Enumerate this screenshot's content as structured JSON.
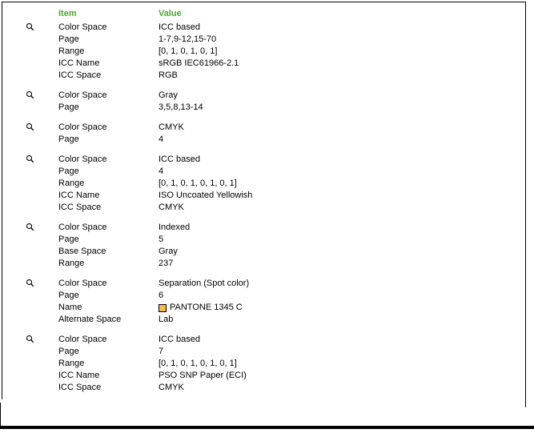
{
  "headers": {
    "item": "Item",
    "value": "Value"
  },
  "swatchColor": "#f5b94f",
  "sections": [
    {
      "rows": [
        {
          "label": "Color Space",
          "value": "ICC based"
        },
        {
          "label": "Page",
          "value": "1-7,9-12,15-70"
        },
        {
          "label": "Range",
          "value": "[0, 1, 0, 1, 0, 1]"
        },
        {
          "label": "ICC Name",
          "value": "sRGB IEC61966-2.1"
        },
        {
          "label": "ICC Space",
          "value": "RGB"
        }
      ]
    },
    {
      "rows": [
        {
          "label": "Color Space",
          "value": "Gray"
        },
        {
          "label": "Page",
          "value": "3,5,8,13-14"
        }
      ]
    },
    {
      "rows": [
        {
          "label": "Color Space",
          "value": "CMYK"
        },
        {
          "label": "Page",
          "value": "4"
        }
      ]
    },
    {
      "rows": [
        {
          "label": "Color Space",
          "value": "ICC based"
        },
        {
          "label": "Page",
          "value": "4"
        },
        {
          "label": "Range",
          "value": "[0, 1, 0, 1, 0, 1, 0, 1]"
        },
        {
          "label": "ICC Name",
          "value": "ISO Uncoated Yellowish"
        },
        {
          "label": "ICC Space",
          "value": "CMYK"
        }
      ]
    },
    {
      "rows": [
        {
          "label": "Color Space",
          "value": "Indexed"
        },
        {
          "label": "Page",
          "value": "5"
        },
        {
          "label": "Base Space",
          "value": "Gray"
        },
        {
          "label": "Range",
          "value": "237"
        }
      ]
    },
    {
      "rows": [
        {
          "label": "Color Space",
          "value": "Separation (Spot color)"
        },
        {
          "label": "Page",
          "value": "6"
        },
        {
          "label": "Name",
          "value": " PANTONE 1345 C",
          "swatch": true
        },
        {
          "label": "Alternate Space",
          "value": "Lab"
        }
      ]
    },
    {
      "rows": [
        {
          "label": "Color Space",
          "value": "ICC based"
        },
        {
          "label": "Page",
          "value": "7"
        },
        {
          "label": "Range",
          "value": "[0, 1, 0, 1, 0, 1, 0, 1]"
        },
        {
          "label": "ICC Name",
          "value": "PSO SNP Paper (ECI)"
        },
        {
          "label": "ICC Space",
          "value": "CMYK"
        }
      ]
    }
  ]
}
